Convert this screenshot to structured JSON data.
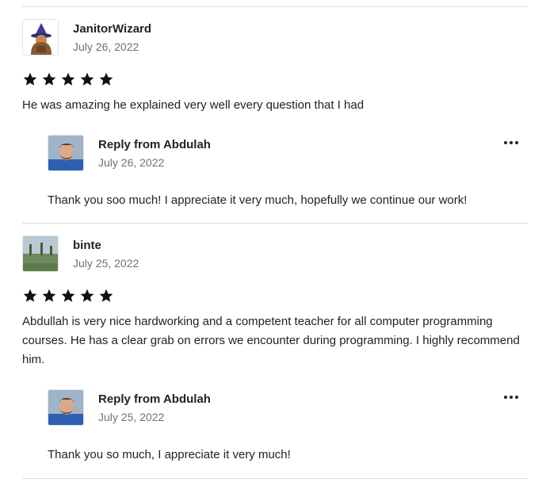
{
  "reviews": [
    {
      "author": "JanitorWizard",
      "date": "July 26, 2022",
      "rating": 5,
      "text": "He was amazing he explained very well every question that I had",
      "reply": {
        "title": "Reply from Abdulah",
        "date": "July 26, 2022",
        "text": "Thank you soo much! I appreciate it very much, hopefully we continue our work!"
      }
    },
    {
      "author": "binte",
      "date": "July 25, 2022",
      "rating": 5,
      "text": "Abdullah is very nice hardworking and a competent teacher for all computer programming courses. He has a clear grab on errors we encounter during programming. I highly recommend him.",
      "reply": {
        "title": "Reply from Abdulah",
        "date": "July 25, 2022",
        "text": "Thank you so much, I appreciate it very much!"
      }
    }
  ],
  "icons": {
    "star": "star-icon",
    "menu": "more-options-icon"
  },
  "colors": {
    "text": "#222222",
    "muted": "#717171",
    "divider": "#dddddd",
    "star": "#111111"
  }
}
